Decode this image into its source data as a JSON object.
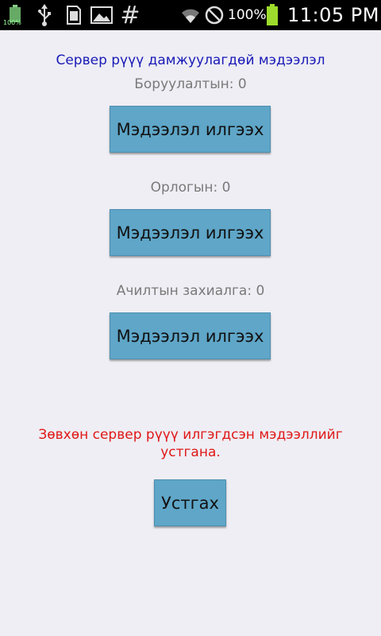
{
  "status_bar": {
    "small_battery_pct": "100%",
    "battery_pct": "100%",
    "time": "11:05 PM",
    "icons": [
      "battery-icon",
      "usb-icon",
      "sd-card-icon",
      "image-icon",
      "hash-icon",
      "wifi-icon",
      "no-signal-icon",
      "battery-full-icon"
    ]
  },
  "screen": {
    "title": "Сервер рүүү дамжуулагдөй мэдээлэл",
    "sections": [
      {
        "label": "Боруулалтын: 0",
        "button": "Мэдээлэл илгээх"
      },
      {
        "label": "Орлогын: 0",
        "button": "Мэдээлэл илгээх"
      },
      {
        "label": "Ачилтын захиалга: 0",
        "button": "Мэдээлэл илгээх"
      }
    ],
    "warning": "Зөвхөн сервер рүүү илгэгдсэн мэдээллийг устгана.",
    "delete_button": "Устгах"
  },
  "colors": {
    "background": "#eeeef4",
    "title": "#1a1ab8",
    "label": "#7a7a7a",
    "button": "#5fa6c8",
    "warning": "#e01818"
  }
}
